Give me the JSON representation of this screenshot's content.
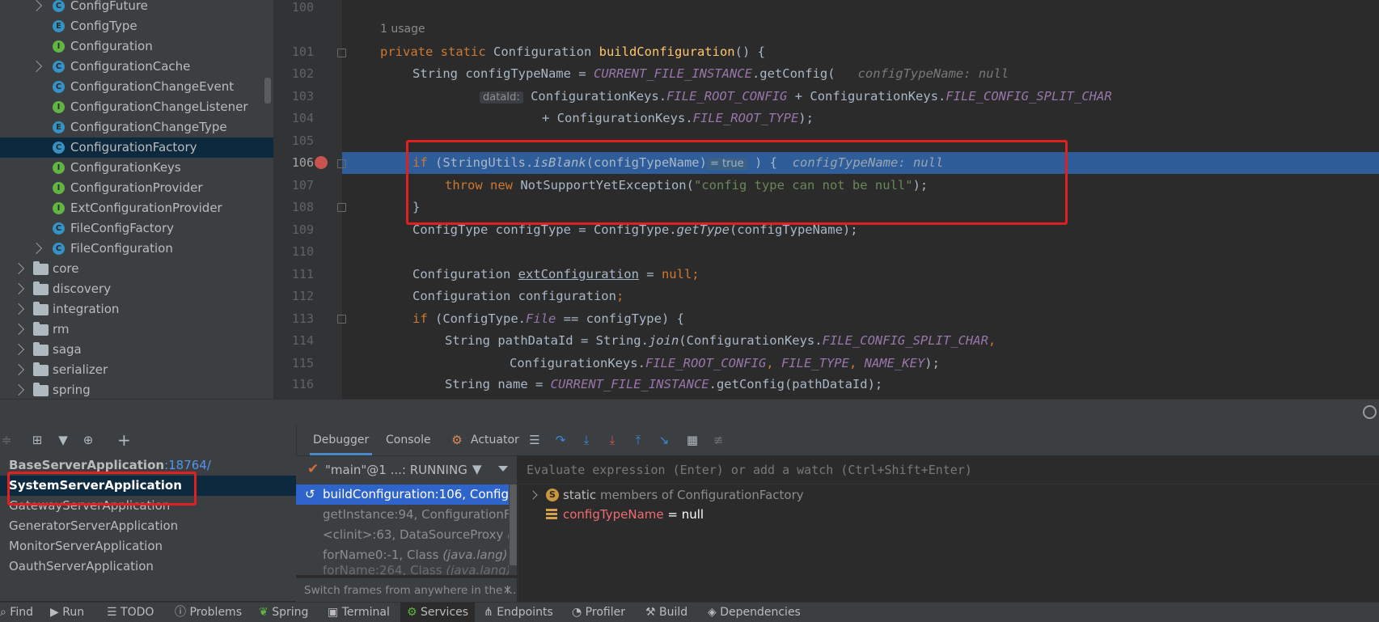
{
  "project_tree": {
    "items": [
      {
        "label": "ConfigFuture",
        "kind": "class",
        "expandable": true
      },
      {
        "label": "ConfigType",
        "kind": "enum",
        "expandable": false
      },
      {
        "label": "Configuration",
        "kind": "interface",
        "expandable": false
      },
      {
        "label": "ConfigurationCache",
        "kind": "class",
        "expandable": true
      },
      {
        "label": "ConfigurationChangeEvent",
        "kind": "class",
        "expandable": false
      },
      {
        "label": "ConfigurationChangeListener",
        "kind": "interface",
        "expandable": false
      },
      {
        "label": "ConfigurationChangeType",
        "kind": "enum",
        "expandable": false
      },
      {
        "label": "ConfigurationFactory",
        "kind": "class",
        "expandable": false,
        "selected": true
      },
      {
        "label": "ConfigurationKeys",
        "kind": "interface",
        "expandable": false
      },
      {
        "label": "ConfigurationProvider",
        "kind": "interface",
        "expandable": false
      },
      {
        "label": "ExtConfigurationProvider",
        "kind": "interface",
        "expandable": false
      },
      {
        "label": "FileConfigFactory",
        "kind": "class",
        "expandable": false
      },
      {
        "label": "FileConfiguration",
        "kind": "class",
        "expandable": true
      },
      {
        "label": "core",
        "kind": "folder"
      },
      {
        "label": "discovery",
        "kind": "folder"
      },
      {
        "label": "integration",
        "kind": "folder"
      },
      {
        "label": "rm",
        "kind": "folder"
      },
      {
        "label": "saga",
        "kind": "folder"
      },
      {
        "label": "serializer",
        "kind": "folder"
      },
      {
        "label": "spring",
        "kind": "folder"
      }
    ]
  },
  "editor": {
    "usage_hint": "1 usage",
    "line_numbers": [
      "100",
      "101",
      "102",
      "103",
      "104",
      "105",
      "106",
      "107",
      "108",
      "109",
      "110",
      "111",
      "112",
      "113",
      "114",
      "115",
      "116"
    ],
    "code": {
      "l101_kw": "private static ",
      "l101_type": "Configuration ",
      "l101_method": "buildConfiguration",
      "l101_rest": "() {",
      "l102_a": "String configTypeName = ",
      "l102_field": "CURRENT_FILE_INSTANCE",
      "l102_b": ".getConfig(",
      "l102_hint": "configTypeName: null",
      "l103_inlay": "dataId:",
      "l103_a": "ConfigurationKeys.",
      "l103_f1": "FILE_ROOT_CONFIG",
      "l103_b": " + ConfigurationKeys.",
      "l103_f2": "FILE_CONFIG_SPLIT_CHAR",
      "l104_a": "+ ConfigurationKeys.",
      "l104_f": "FILE_ROOT_TYPE",
      "l104_b": ");",
      "l106_kw": "if",
      "l106_a": " (StringUtils.",
      "l106_m": "isBlank",
      "l106_b": "(configTypeName)",
      "l106_inlay": "= true",
      "l106_c": " ) {",
      "l106_hint": "configTypeName: null",
      "l107_kw": "throw new ",
      "l107_a": "NotSupportYetException(",
      "l107_str": "\"config type can not be null\"",
      "l107_b": ");",
      "l108": "}",
      "l109_a": "ConfigType configType = ConfigType.",
      "l109_m": "getType",
      "l109_b": "(configTypeName);",
      "l111_a": "Configuration ",
      "l111_var": "extConfiguration",
      "l111_b": " = ",
      "l111_kw": "null",
      "l111_c": ";",
      "l112_a": "Configuration configuration",
      "l112_b": ";",
      "l113_kw": "if",
      "l113_a": " (ConfigType.",
      "l113_f": "File",
      "l113_b": " == configType) {",
      "l114_a": "String pathDataId = String.",
      "l114_m": "join",
      "l114_b": "(ConfigurationKeys.",
      "l114_f": "FILE_CONFIG_SPLIT_CHAR",
      "l114_c": ",",
      "l115_a": "ConfigurationKeys.",
      "l115_f1": "FILE_ROOT_CONFIG",
      "l115_b": ", ",
      "l115_f2": "FILE_TYPE",
      "l115_c": ", ",
      "l115_f3": "NAME_KEY",
      "l115_d": ");",
      "l116_a": "String name = ",
      "l116_f": "CURRENT_FILE_INSTANCE",
      "l116_b": ".getConfig(pathDataId);"
    }
  },
  "services": {
    "items": [
      {
        "label": "BaseServerApplication",
        "port": ":18764/"
      },
      {
        "label": "SystemServerApplication",
        "selected": true
      },
      {
        "label": "GatewayServerApplication"
      },
      {
        "label": "GeneratorServerApplication"
      },
      {
        "label": "MonitorServerApplication"
      },
      {
        "label": "OauthServerApplication"
      }
    ]
  },
  "debugger": {
    "tabs": [
      "Debugger",
      "Console",
      "Actuator"
    ],
    "thread": "\"main\"@1 ...: RUNNING",
    "frames": [
      {
        "method": "buildConfiguration:106, ",
        "cls": "Configur",
        "selected": true
      },
      {
        "method": "getInstance:94, ",
        "cls": "ConfigurationFac"
      },
      {
        "method": "<clinit>:63, DataSourceProxy ",
        "cls": "(io."
      },
      {
        "method": "forName0:-1, Class ",
        "cls": "(java.lang)"
      },
      {
        "method": "forName:264, Class ",
        "cls": "(java.lang)"
      }
    ],
    "frames_tip": "Switch frames from anywhere in the I...",
    "eval_placeholder": "Evaluate expression (Enter) or add a watch (Ctrl+Shift+Enter)",
    "variables": [
      {
        "kw": "static",
        "rest": " members of ConfigurationFactory"
      },
      {
        "name": "configTypeName",
        "value": " = null"
      }
    ]
  },
  "statusbar": {
    "items": [
      "Find",
      "Run",
      "TODO",
      "Problems",
      "Spring",
      "Terminal",
      "Services",
      "Endpoints",
      "Profiler",
      "Build",
      "Dependencies"
    ],
    "active": "Services"
  }
}
